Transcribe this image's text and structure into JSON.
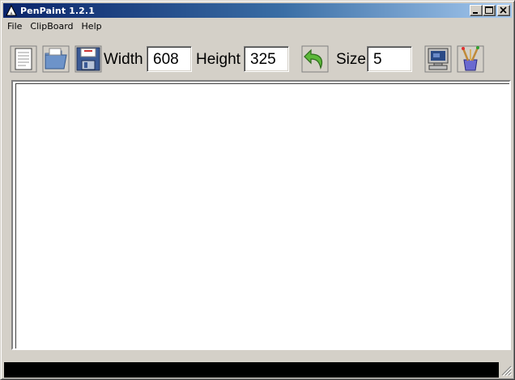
{
  "window": {
    "title": "PenPaint 1.2.1",
    "accent_color": "#0a246a",
    "title_icon": "penpaint-app-icon"
  },
  "menubar": {
    "items": [
      {
        "label": "File"
      },
      {
        "label": "ClipBoard"
      },
      {
        "label": "Help"
      }
    ]
  },
  "toolbar": {
    "new_icon": "new-document-icon",
    "open_icon": "open-folder-icon",
    "save_icon": "save-floppy-icon",
    "width_label": "Width",
    "width_value": "608",
    "height_label": "Height",
    "height_value": "325",
    "undo_icon": "undo-arrow-icon",
    "size_label": "Size",
    "size_value": "5",
    "computer_icon": "computer-icon",
    "brushes_icon": "brushes-icon"
  },
  "canvas": {
    "background": "#ffffff"
  },
  "statusbar": {
    "text": "",
    "background": "#000000"
  }
}
